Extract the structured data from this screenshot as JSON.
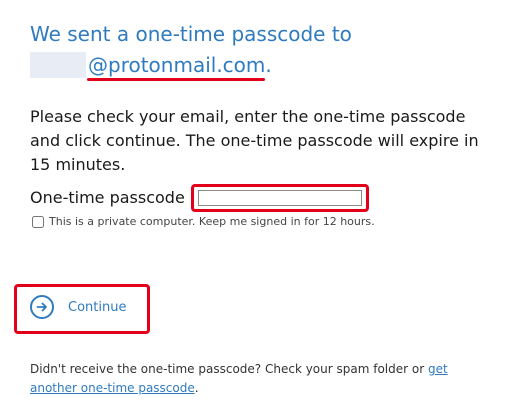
{
  "heading": "We sent a one-time passcode to",
  "email_domain": "@protonmail.com.",
  "instructions": "Please check your email, enter the one-time passcode and click continue. The one-time passcode will expire in 15 minutes.",
  "otp": {
    "label": "One-time passcode",
    "value": "",
    "placeholder": ""
  },
  "remember": {
    "label": "This is a private computer. Keep me signed in for 12 hours.",
    "checked": false
  },
  "continue": {
    "label": "Continue",
    "icon": "arrow-right-circle-icon"
  },
  "footer": {
    "prefix": "Didn't receive the one-time passcode? Check your spam folder or ",
    "link_text": "get another one-time passcode",
    "suffix": "."
  },
  "colors": {
    "accent": "#2f7bbf",
    "annotation": "#e3001b"
  }
}
